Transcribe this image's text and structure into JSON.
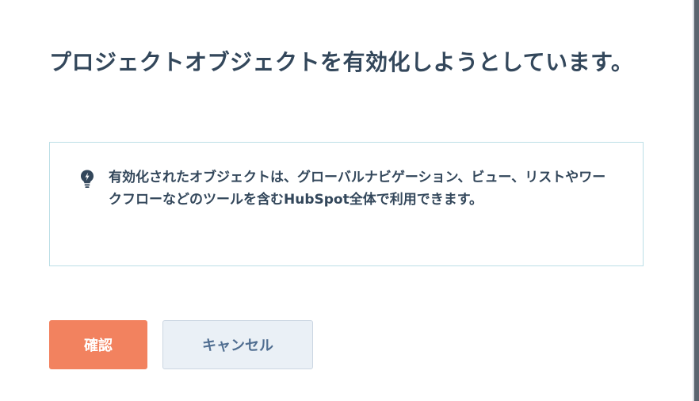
{
  "dialog": {
    "title": "プロジェクトオブジェクトを有効化しようとしています。",
    "info": {
      "icon": "lightbulb-icon",
      "text": "有効化されたオブジェクトは、グローバルナビゲーション、ビュー、リストやワークフローなどのツールを含むHubSpot全体で利用できます。"
    },
    "buttons": {
      "confirm_label": "確認",
      "cancel_label": "キャンセル"
    }
  },
  "colors": {
    "primary_button": "#f2825f",
    "secondary_button": "#eaf0f6",
    "info_border": "#bcdfe6",
    "text": "#33475b"
  }
}
